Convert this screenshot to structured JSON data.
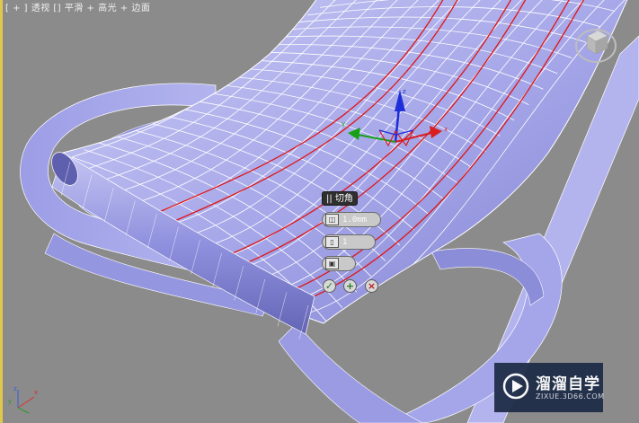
{
  "viewport": {
    "label": "[ + ] 透视 [] 平滑 + 高光 + 边面",
    "background": "#8b8b8b",
    "accent_border": "#e0c84a"
  },
  "caddy": {
    "title": "|| 切角",
    "amount_value": "1.0mm",
    "segments_value": "1",
    "buttons": [
      "ok",
      "apply-and-continue",
      "cancel"
    ]
  },
  "gizmo": {
    "axes": [
      "x",
      "y",
      "z"
    ],
    "colors": {
      "x": "#d81e1e",
      "y": "#18a018",
      "z": "#1e2ed8"
    }
  },
  "axis_tripod": {
    "labels": [
      "z",
      "y",
      "x"
    ]
  },
  "watermark": {
    "title": "溜溜自学",
    "url": "ZIXUE.3D66.COM"
  },
  "mesh_colors": {
    "surface": "#a7a8eb",
    "wire": "#ffffff",
    "selected_edges": "#e01515"
  }
}
